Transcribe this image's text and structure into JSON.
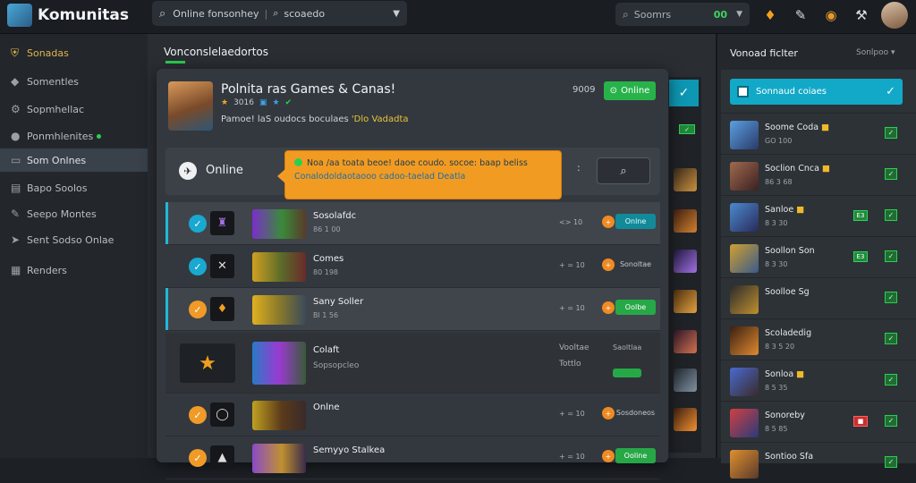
{
  "header": {
    "title": "Komunitas",
    "search_text": "Online fonsonhey",
    "search_sep": "|",
    "search_filter": "scoaedo",
    "search2_placeholder": "Soomrs",
    "search2_value": "00"
  },
  "sidebar": {
    "items": [
      {
        "label": "Sonadas",
        "icon": "shield-icon",
        "glyph": "⛨"
      },
      {
        "label": "Somentles",
        "icon": "tag-icon",
        "glyph": "◆"
      },
      {
        "label": "Sopmhellac",
        "icon": "gear-icon",
        "glyph": "⚙"
      },
      {
        "label": "Ponmhlenites",
        "icon": "chat-icon",
        "glyph": "●"
      },
      {
        "label": "Som Onlnes",
        "icon": "monitor-icon",
        "glyph": "▭"
      },
      {
        "label": "Bapo Soolos",
        "icon": "book-icon",
        "glyph": "▤"
      },
      {
        "label": "Seepo Montes",
        "icon": "edit-icon",
        "glyph": "✎"
      },
      {
        "label": "Sent Sodso Onlae",
        "icon": "send-icon",
        "glyph": "➤"
      },
      {
        "label": "Renders",
        "icon": "grid-icon",
        "glyph": "▦"
      }
    ]
  },
  "main": {
    "heading": "Vonconslelaedortos",
    "panel": {
      "title": "Polnita ras Games & Canas!",
      "sub": "3016",
      "desc_prefix": "Pamoe! laS oudocs boculaes",
      "desc_highlight": "'Dlo Vadadta",
      "count": "9009",
      "online_button": "Online"
    },
    "filter": {
      "label": "Online",
      "dots": ":"
    },
    "tooltip": {
      "line1": "Noa /aa toata beoe! daoe coudo. socoe: baap beliss",
      "line2": "Conalodoldaotaooo cadoo-taelad Deatla"
    },
    "rows": [
      {
        "name": "Sosolafdc",
        "sub": "86 1 00",
        "meta": "<> 10",
        "button": "Onlne",
        "status": "check"
      },
      {
        "name": "Comes",
        "sub": "80 198",
        "meta": "+ = 10",
        "button": "Sonoltae",
        "status": "check"
      },
      {
        "name": "Sany Soller",
        "sub": "Bl 1 56",
        "meta": "+ = 10",
        "button": "Oolbe",
        "status": "pending"
      },
      {
        "name": "Colaft",
        "sub": "Sopsopcleo",
        "meta": "Vooltae",
        "meta2": "Tottlo",
        "button": "Saoltlaa",
        "status": "game"
      },
      {
        "name": "Onlne",
        "sub": "",
        "meta": "+ = 10",
        "button": "Sosdoneos",
        "status": "pending"
      },
      {
        "name": "Semyyo Stalkea",
        "sub": "",
        "meta": "+ = 10",
        "button": "Ooline",
        "status": "pending"
      }
    ]
  },
  "right": {
    "title": "Vonoad ficlter",
    "sort": "Sonlpoo",
    "selected": "Sonnaud coiaes",
    "items": [
      {
        "name": "Soome Coda",
        "sub": "GO 100",
        "badge": ""
      },
      {
        "name": "Soclion Cnca",
        "sub": "86 3 68",
        "badge": ""
      },
      {
        "name": "Sanloe",
        "sub": "8 3 30",
        "badge": "E3"
      },
      {
        "name": "Soollon Son",
        "sub": "8 3 30",
        "badge": "E3"
      },
      {
        "name": "Soolloe Sg",
        "sub": "",
        "badge": ""
      },
      {
        "name": "Scoladedig",
        "sub": "8 3 5 20",
        "badge": ""
      },
      {
        "name": "Sonloa",
        "sub": "8 5 35",
        "badge": ""
      },
      {
        "name": "Sonoreby",
        "sub": "8 5 85",
        "badge": "red"
      },
      {
        "name": "Sontioo Sfa",
        "sub": "",
        "badge": ""
      }
    ]
  },
  "colors": {
    "accent_green": "#2bd04f",
    "accent_teal": "#12a9c8",
    "tooltip_orange": "#f29b23",
    "background": "#1d2126"
  }
}
